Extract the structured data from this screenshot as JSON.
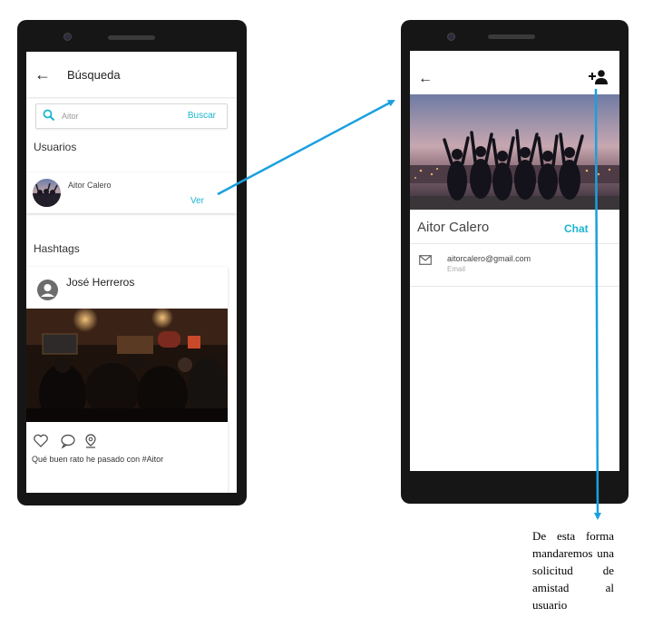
{
  "left_screen": {
    "title": "Búsqueda",
    "search": {
      "value": "Aitor",
      "button_label": "Buscar"
    },
    "users_section_label": "Usuarios",
    "user_result": {
      "name": "Aitor Calero",
      "action_label": "Ver"
    },
    "hashtags_section_label": "Hashtags",
    "post": {
      "author": "José Herreros",
      "caption": "Qué buen rato he pasado con #Aitor",
      "actions": [
        "heart-icon",
        "comment-icon",
        "location-pin-icon"
      ]
    }
  },
  "right_screen": {
    "profile_name": "Aitor Calero",
    "chat_label": "Chat",
    "email": {
      "value": "aitorcalero@gmail.com",
      "label": "Email"
    },
    "top_actions": [
      "back-arrow-icon",
      "add-person-icon"
    ]
  },
  "annotation": "De esta forma mandaremos una solicitud de amistad al usuario",
  "colors": {
    "accent": "#1bb6d0",
    "arrow": "#1aa0e0",
    "phone_body": "#161616"
  }
}
